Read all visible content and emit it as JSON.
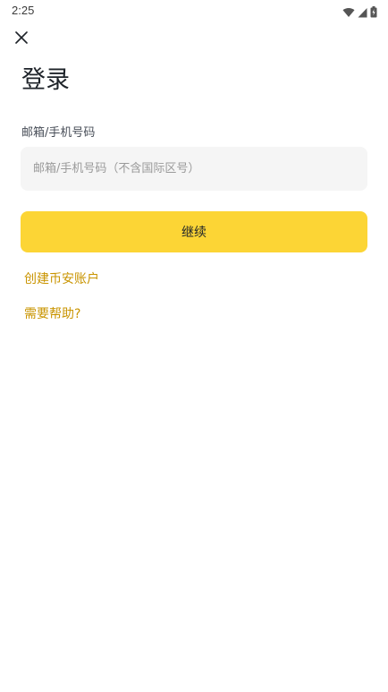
{
  "status_bar": {
    "time": "2:25",
    "icons": [
      "wifi-icon",
      "cell-signal-icon",
      "battery-charging-icon"
    ]
  },
  "header": {
    "close_icon": "close-icon"
  },
  "login": {
    "title": "登录",
    "field_label": "邮箱/手机号码",
    "input_placeholder": "邮箱/手机号码（不含国际区号）",
    "input_value": "",
    "continue_label": "继续",
    "create_account_link": "创建币安账户",
    "help_link": "需要帮助?"
  },
  "colors": {
    "accent": "#fcd535",
    "link": "#c99400",
    "input_bg": "#f5f5f5",
    "text": "#1e2329"
  }
}
